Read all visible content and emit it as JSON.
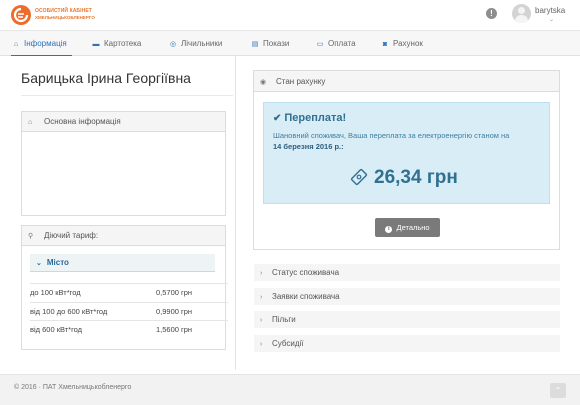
{
  "brand": {
    "line1": "ОСОБИСТИЙ КАБІНЕТ",
    "line2": "ХМЕЛЬНИЦЬКОБЛЕНЕРГО",
    "color": "#ee6c2a"
  },
  "header": {
    "alert_icon": "exclamation-circle-icon",
    "username": "barytska",
    "user_menu_icon": "chevron-down-icon"
  },
  "nav": {
    "accent": "#2e71b8",
    "items": [
      {
        "label": "Інформація",
        "icon": "home-icon",
        "glyph": "⌂",
        "active": true
      },
      {
        "label": "Картотека",
        "icon": "id-card-icon",
        "glyph": "▬",
        "active": false
      },
      {
        "label": "Лічильники",
        "icon": "dashboard-icon",
        "glyph": "◎",
        "active": false
      },
      {
        "label": "Покази",
        "icon": "clipboard-icon",
        "glyph": "▤",
        "active": false
      },
      {
        "label": "Оплата",
        "icon": "credit-card-icon",
        "glyph": "▭",
        "active": false
      },
      {
        "label": "Рахунок",
        "icon": "money-icon",
        "glyph": "◙",
        "active": false
      }
    ]
  },
  "person": {
    "name": "Барицька Ірина Георгіївна"
  },
  "basic_info": {
    "title": "Основна інформація",
    "icon": "home-icon"
  },
  "tariff": {
    "title": "Діючий тариф:",
    "icon": "lightbulb-icon",
    "group": "Місто",
    "rows": [
      {
        "label": "до 100 кВт*год",
        "price": "0,5700 грн"
      },
      {
        "label": "від 100 до 600 кВт*год",
        "price": "0,9900 грн"
      },
      {
        "label": "від 600 кВт*год",
        "price": "1,5600 грн"
      }
    ]
  },
  "account_status": {
    "title": "Стан рахунку",
    "icon": "eye-icon",
    "alert": {
      "title": "Переплата!",
      "text": "Шановний споживач, Ваша переплата за електроенергію станом на",
      "date": "14 березня 2016 р.:",
      "amount": "26,34 грн",
      "amount_icon": "money-tag-icon",
      "bg_color": "#d9edf7",
      "text_color": "#31708f"
    },
    "details_button": "Детально"
  },
  "accordion": [
    {
      "label": "Статус споживача"
    },
    {
      "label": "Заявки споживача"
    },
    {
      "label": "Пільги"
    },
    {
      "label": "Субсидії"
    }
  ],
  "footer": {
    "text": "© 2016 · ПАТ Хмельницькобленерго",
    "scroll_top_icon": "chevron-up-icon"
  }
}
